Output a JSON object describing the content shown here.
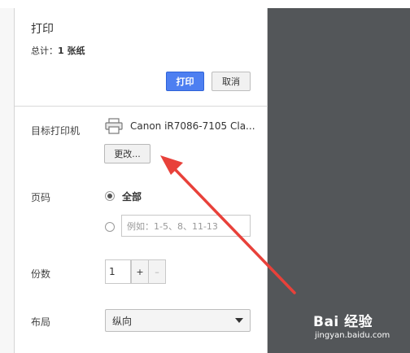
{
  "header": {
    "title": "打印",
    "summary_prefix": "总计：",
    "summary_value": "1 张纸"
  },
  "actions": {
    "print_label": "打印",
    "cancel_label": "取消"
  },
  "destination": {
    "label": "目标打印机",
    "printer_name": "Canon iR7086-7105 Cla...",
    "change_label": "更改..."
  },
  "pages": {
    "label": "页码",
    "option_all": "全部",
    "option_all_selected": true,
    "custom_placeholder": "例如：1-5、8、11-13"
  },
  "copies": {
    "label": "份数",
    "value": "1",
    "increment": "+",
    "decrement": "–"
  },
  "layout": {
    "label": "布局",
    "selected": "纵向"
  },
  "watermark": {
    "brand": "Bai 经验",
    "url": "jingyan.baidu.com"
  },
  "colors": {
    "print_button": "#4d7ff1",
    "preview_background": "#535659",
    "annotation_arrow": "#e8413a"
  }
}
